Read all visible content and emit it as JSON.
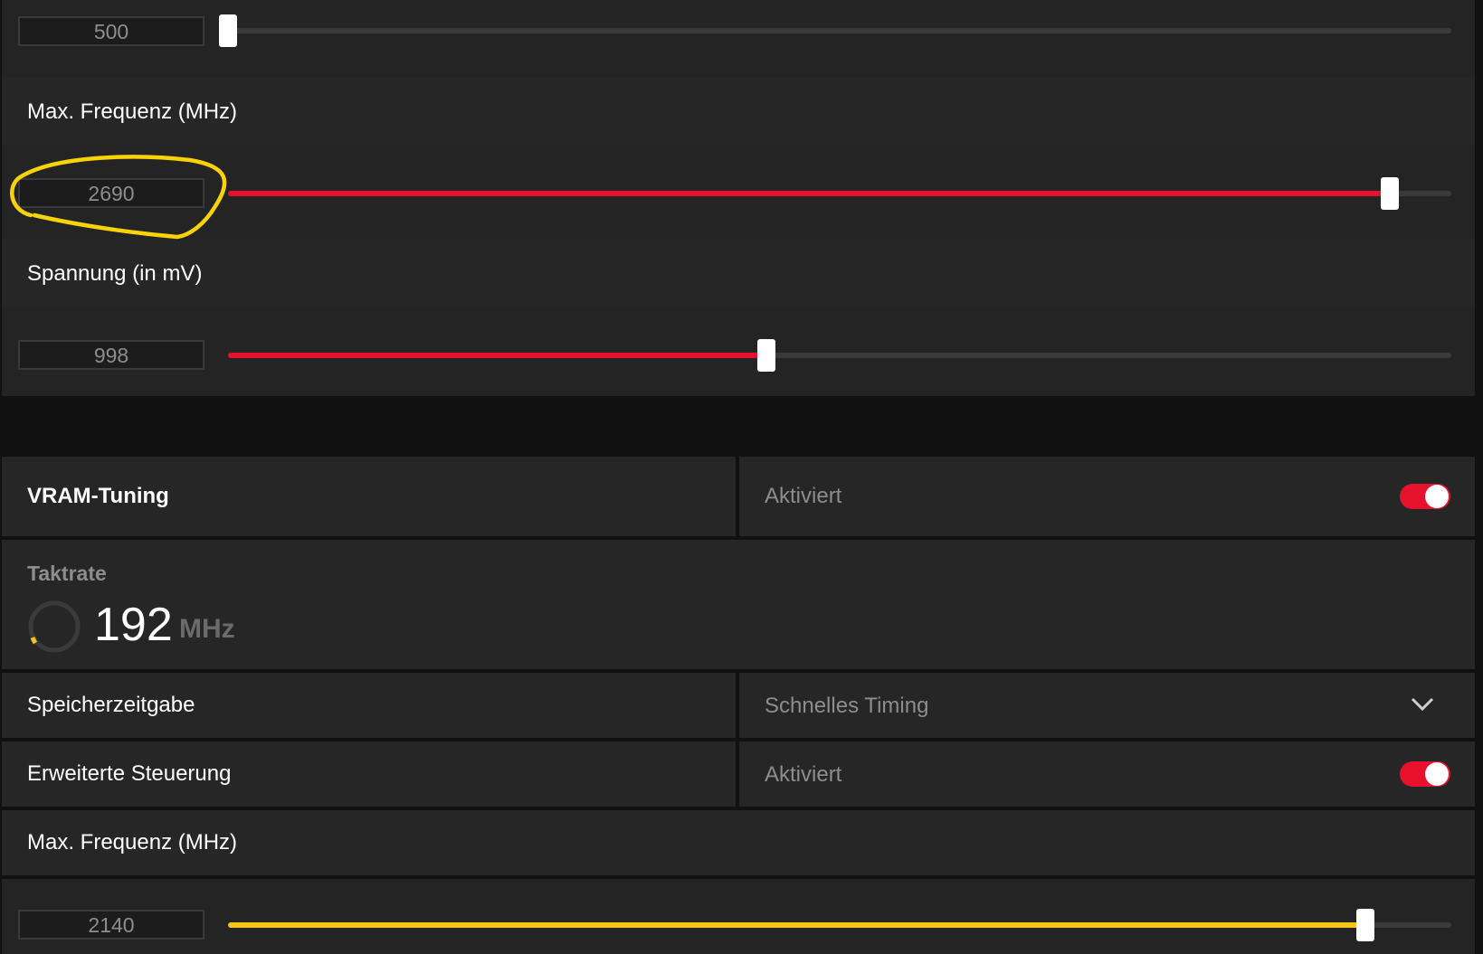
{
  "accent_red": "#e8112d",
  "accent_yellow": "#f5c518",
  "gpu": {
    "min_freq": {
      "value": "500",
      "level_percent": 0
    },
    "max_freq": {
      "label": "Max. Frequenz (MHz)",
      "value": "2690",
      "level_percent": 95
    },
    "voltage": {
      "label": "Spannung (in mV)",
      "value": "998",
      "level_percent": 44
    }
  },
  "vram": {
    "title": "VRAM-Tuning",
    "status": "Aktiviert",
    "enabled": true,
    "clock": {
      "label": "Taktrate",
      "value": "192",
      "unit": "MHz"
    },
    "timing": {
      "label": "Speicherzeitgabe",
      "value": "Schnelles Timing"
    },
    "advanced": {
      "label": "Erweiterte Steuerung",
      "status": "Aktiviert",
      "enabled": true
    },
    "max_freq": {
      "label": "Max. Frequenz (MHz)",
      "value": "2140",
      "level_percent": 93
    }
  },
  "icons": {
    "gauge": "gauge-icon",
    "dropdown": "chevron-down-icon",
    "annotation": "highlight-circle"
  }
}
